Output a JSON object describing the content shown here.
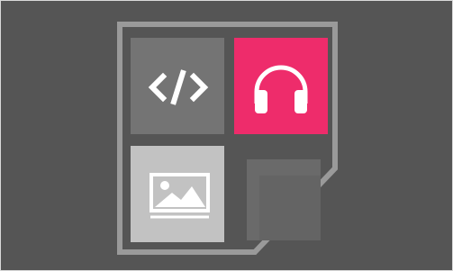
{
  "icons": {
    "code": "code-brackets-icon",
    "headphones": "headphones-icon",
    "image": "image-landscape-icon"
  },
  "colors": {
    "background": "#555555",
    "outline": "#9a9a9a",
    "code_tile": "#747474",
    "music_tile": "#ee2c6b",
    "image_tile": "#c2c2c2",
    "empty_tile": "#6a6a6a"
  }
}
